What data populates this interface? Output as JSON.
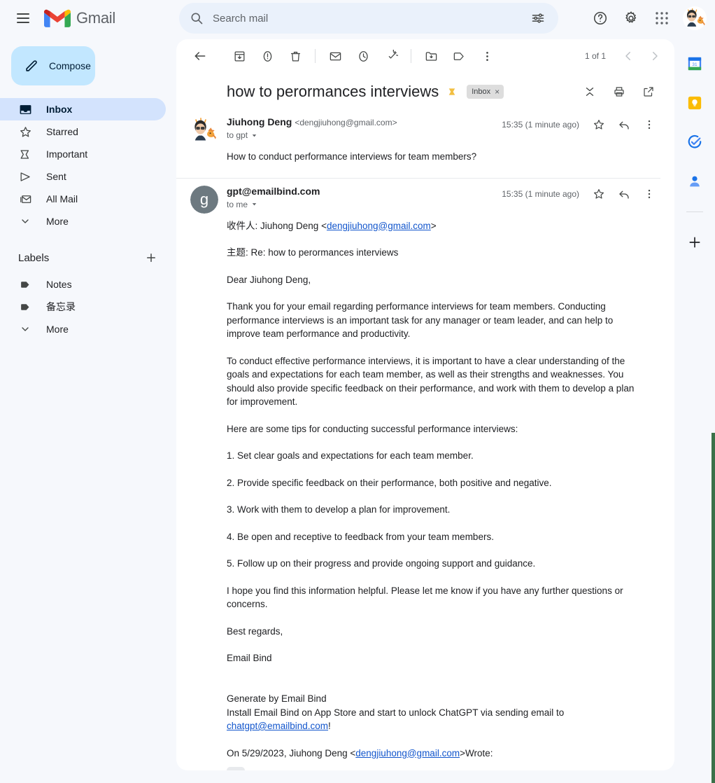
{
  "app": {
    "brand": "Gmail",
    "menu_icon": "hamburger-icon",
    "accent_blue": "#1a73e8",
    "chip_bg": "#dddddd"
  },
  "search": {
    "placeholder": "Search mail",
    "value": "",
    "search_icon": "search-icon",
    "options_icon": "tune-options-icon"
  },
  "top_actions": {
    "support": "help-icon",
    "settings": "gear-icon",
    "apps": "apps-grid-icon",
    "account": "account-avatar"
  },
  "sidebar": {
    "compose_label": "Compose",
    "compose_icon": "pencil-icon",
    "items": [
      {
        "label": "Inbox",
        "icon": "inbox-icon",
        "active": true
      },
      {
        "label": "Starred",
        "icon": "star-icon",
        "active": false
      },
      {
        "label": "Important",
        "icon": "important-marker-icon",
        "active": false
      },
      {
        "label": "Sent",
        "icon": "send-icon",
        "active": false
      },
      {
        "label": "All Mail",
        "icon": "all-mail-icon",
        "active": false
      },
      {
        "label": "More",
        "icon": "chevron-down-icon",
        "active": false
      }
    ],
    "labels_title": "Labels",
    "labels_add_icon": "plus-icon",
    "labels": [
      {
        "label": "Notes",
        "icon": "label-tag-icon"
      },
      {
        "label": "备忘录",
        "icon": "label-tag-icon"
      },
      {
        "label": "More",
        "icon": "chevron-down-icon"
      }
    ]
  },
  "toolbar": {
    "back": "back-arrow-icon",
    "archive": "archive-icon",
    "report_spam": "report-spam-icon",
    "delete": "trash-icon",
    "mark_unread": "mark-unread-icon",
    "snooze": "snooze-clock-icon",
    "add_to_tasks": "add-to-tasks-icon",
    "move_to": "move-to-folder-icon",
    "labels": "label-tag-icon",
    "more": "more-vertical-icon",
    "pager_text": "1 of 1",
    "prev": "chevron-left-icon",
    "next": "chevron-right-icon"
  },
  "thread": {
    "subject": "how to perormances interviews",
    "important_marker_icon": "important-marker-icon",
    "label_chip": "Inbox",
    "label_chip_remove": "×",
    "collapse_all_icon": "collapse-all-icon",
    "print_icon": "print-icon",
    "popout_icon": "open-in-new-icon"
  },
  "messages": [
    {
      "avatar_type": "image",
      "avatar_name": "sender-avatar-photo",
      "sender_name": "Jiuhong Deng",
      "sender_email": "<dengjiuhong@gmail.com>",
      "recipient": "to gpt",
      "time": "15:35 (1 minute ago)",
      "star_icon": "star-icon",
      "reply_icon": "reply-arrow-icon",
      "more_icon": "more-vertical-icon",
      "body": [
        {
          "text": "How to conduct performance interviews for team members?"
        }
      ]
    },
    {
      "avatar_type": "letter",
      "avatar_name": "sender-avatar-letter",
      "avatar_letter": "g",
      "sender_name": "gpt@emailbind.com",
      "sender_email": "",
      "recipient": "to me",
      "time": "15:35 (1 minute ago)",
      "star_icon": "star-icon",
      "reply_icon": "reply-arrow-icon",
      "more_icon": "more-vertical-icon",
      "body": [
        {
          "prefix": "收件人: Jiuhong Deng <",
          "link": "dengjiuhong@gmail.com",
          "suffix": ">"
        },
        {
          "text": "主题: Re: how to perormances interviews"
        },
        {
          "text": "Dear Jiuhong Deng,"
        },
        {
          "text": "Thank you for your email regarding performance interviews for team members. Conducting performance interviews is an important task for any manager or team leader, and can help to improve team performance and productivity."
        },
        {
          "text": "To conduct effective performance interviews, it is important to have a clear understanding of the goals and expectations for each team member, as well as their strengths and weaknesses. You should also provide specific feedback on their performance, and work with them to develop a plan for improvement."
        },
        {
          "text": "Here are some tips for conducting successful performance interviews:"
        },
        {
          "text": "1. Set clear goals and expectations for each team member."
        },
        {
          "text": "2. Provide specific feedback on their performance, both positive and negative."
        },
        {
          "text": "3. Work with them to develop a plan for improvement."
        },
        {
          "text": "4. Be open and receptive to feedback from your team members."
        },
        {
          "text": "5. Follow up on their progress and provide ongoing support and guidance."
        },
        {
          "text": "I hope you find this information helpful. Please let me know if you have any further questions or concerns."
        },
        {
          "text": "Best regards,"
        },
        {
          "text": "Email Bind"
        },
        {
          "prefix": "Generate by Email Bind\nInstall Email Bind on App Store and start to unlock ChatGPT via sending email to ",
          "link": "chatgpt@emailbind.com",
          "suffix": "!"
        },
        {
          "prefix": "On 5/29/2023, Jiuhong Deng <",
          "link": "dengjiuhong@gmail.com",
          "suffix": ">Wrote:"
        }
      ],
      "expand_quoted_icon": "expand-quoted-dots"
    }
  ],
  "right_rail": {
    "items": [
      {
        "name": "google-calendar-icon",
        "label": "Calendar",
        "day": "31"
      },
      {
        "name": "google-keep-icon",
        "label": "Keep"
      },
      {
        "name": "google-tasks-icon",
        "label": "Tasks"
      },
      {
        "name": "google-contacts-icon",
        "label": "Contacts"
      },
      {
        "name": "add-addon-icon",
        "label": "Get add-ons"
      }
    ]
  }
}
